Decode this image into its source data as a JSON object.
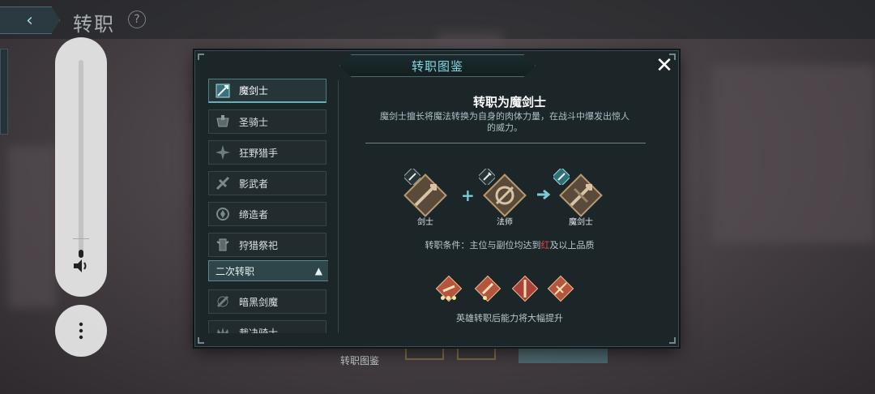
{
  "top_bar": {
    "title": "转职",
    "help": "?",
    "back": "‹"
  },
  "bottom": {
    "label": "转职图鉴"
  },
  "dialog": {
    "title": "转职图鉴",
    "close": "✕",
    "sidebar": {
      "items": [
        {
          "label": "魔剑士",
          "selected": true
        },
        {
          "label": "圣骑士"
        },
        {
          "label": "狂野猎手"
        },
        {
          "label": "影武者"
        },
        {
          "label": "缔造者"
        },
        {
          "label": "狩猎祭祀"
        }
      ],
      "section_header": "二次转职",
      "section_items": [
        {
          "label": "暗黑剑魔"
        },
        {
          "label": "裁决骑士"
        }
      ]
    },
    "content": {
      "title": "转职为魔剑士",
      "description": "魔剑士擅长将魔法转换为自身的肉体力量，在战斗中爆发出惊人的威力。",
      "plus": "+",
      "classes": [
        {
          "label": "剑士"
        },
        {
          "label": "法师"
        },
        {
          "label": "魔剑士"
        }
      ],
      "condition_prefix": "转职条件：主位与副位均达到",
      "condition_highlight": "红",
      "condition_suffix": "及以上品质",
      "quality_text": "英雄转职后能力将大幅提升",
      "accent_red": "#e2464a"
    }
  }
}
